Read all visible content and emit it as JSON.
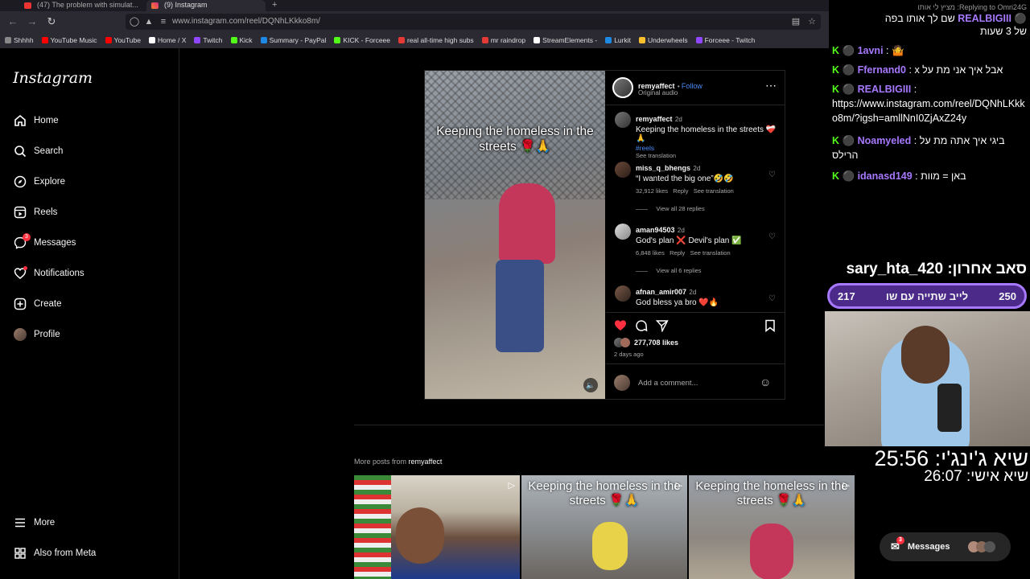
{
  "browser": {
    "tabs": [
      {
        "label": "(47) The problem with simulat..."
      },
      {
        "label": "(9) Instagram"
      }
    ],
    "new_tab": "+",
    "url": "www.instagram.com/reel/DQNhLKkko8m/",
    "bookmarks": [
      {
        "label": "Shhhh",
        "color": "#888888"
      },
      {
        "label": "YouTube Music",
        "color": "#ff0000"
      },
      {
        "label": "YouTube",
        "color": "#ff0000"
      },
      {
        "label": "Home / X",
        "color": "#ffffff"
      },
      {
        "label": "Twitch",
        "color": "#9146ff"
      },
      {
        "label": "Kick",
        "color": "#53fc18"
      },
      {
        "label": "Summary - PayPal",
        "color": "#1e88e5"
      },
      {
        "label": "KICK - Forceee",
        "color": "#53fc18"
      },
      {
        "label": "real all-time high subs",
        "color": "#e53935"
      },
      {
        "label": "mr raindrop",
        "color": "#e53935"
      },
      {
        "label": "StreamElements -",
        "color": "#ffffff"
      },
      {
        "label": "Lurkit",
        "color": "#1e88e5"
      },
      {
        "label": "Underwheels",
        "color": "#fbc02d"
      },
      {
        "label": "Forceee - Twitch",
        "color": "#9146ff"
      }
    ]
  },
  "sidebar": {
    "logo": "Instagram",
    "items": [
      {
        "label": "Home",
        "icon": "home-icon"
      },
      {
        "label": "Search",
        "icon": "search-icon"
      },
      {
        "label": "Explore",
        "icon": "compass-icon"
      },
      {
        "label": "Reels",
        "icon": "reels-icon"
      },
      {
        "label": "Messages",
        "icon": "messenger-icon",
        "badge": "3"
      },
      {
        "label": "Notifications",
        "icon": "heart-icon"
      },
      {
        "label": "Create",
        "icon": "plus-icon"
      },
      {
        "label": "Profile",
        "icon": "avatar-icon"
      }
    ],
    "more": "More",
    "meta": "Also from Meta"
  },
  "post": {
    "video_caption": "Keeping the homeless in the streets 🌹🙏",
    "author": "remyaffect",
    "follow": "Follow",
    "audio": "Original audio",
    "caption": {
      "user": "remyaffect",
      "time": "2d",
      "text": "Keeping the homeless in the streets ❤️‍🩹🙏",
      "tag": "#reels",
      "translate": "See translation"
    },
    "comments": [
      {
        "user": "miss_q_bhengs",
        "time": "2d",
        "text": "“I wanted the big one”🤣🤣",
        "likes": "32,912 likes",
        "reply": "Reply",
        "translate": "See translation",
        "replies": "View all 28 replies"
      },
      {
        "user": "aman94503",
        "time": "2d",
        "text": "God's plan ❌ Devil's plan ✅",
        "likes": "6,848 likes",
        "reply": "Reply",
        "translate": "See translation",
        "replies": "View all 6 replies"
      },
      {
        "user": "afnan_amir007",
        "time": "2d",
        "text": "God bless ya bro ❤️🔥"
      }
    ],
    "likes": "277,708 likes",
    "date": "2 days ago",
    "add_comment": "Add a comment..."
  },
  "more_posts": {
    "label": "More posts from",
    "author": "remyaffect",
    "thumbs": [
      {
        "caption": ""
      },
      {
        "caption": "Keeping the homeless in the streets 🌹🙏"
      },
      {
        "caption": "Keeping the homeless in the streets 🌹🙏"
      }
    ]
  },
  "messages_pill": {
    "label": "Messages",
    "badge": "3"
  },
  "overlay": {
    "reply_banner": "Replying to Omri24G: מציץ לי אותו",
    "chat": [
      {
        "name": "REALBIGIII",
        "text": "שם לך אותו בפה"
      },
      {
        "name": "",
        "text": "של 3 שעות"
      },
      {
        "name": "1avni",
        "text": "🤷"
      },
      {
        "name": "Ffernand0",
        "text": "x אבל איך אני מת על"
      },
      {
        "name": "REALBIGIII",
        "text": "https://www.instagram.com/reel/DQNhLKkko8m/?igsh=amllNnI0ZjAxZ24y"
      },
      {
        "name": "Noamyeled",
        "text": "ביגי איך אתה מת על הרילס"
      },
      {
        "name": "idanasd149",
        "text": "באן = מוות"
      }
    ],
    "last_sub": "סאב אחרון: sary_hta_420",
    "goal": {
      "current": "217",
      "text": "לייב שתייה עם שו",
      "target": "250"
    },
    "timer_main": "שיא ג'ינג'י: 25:56",
    "timer_personal": "שיא אישי: 26:07"
  }
}
